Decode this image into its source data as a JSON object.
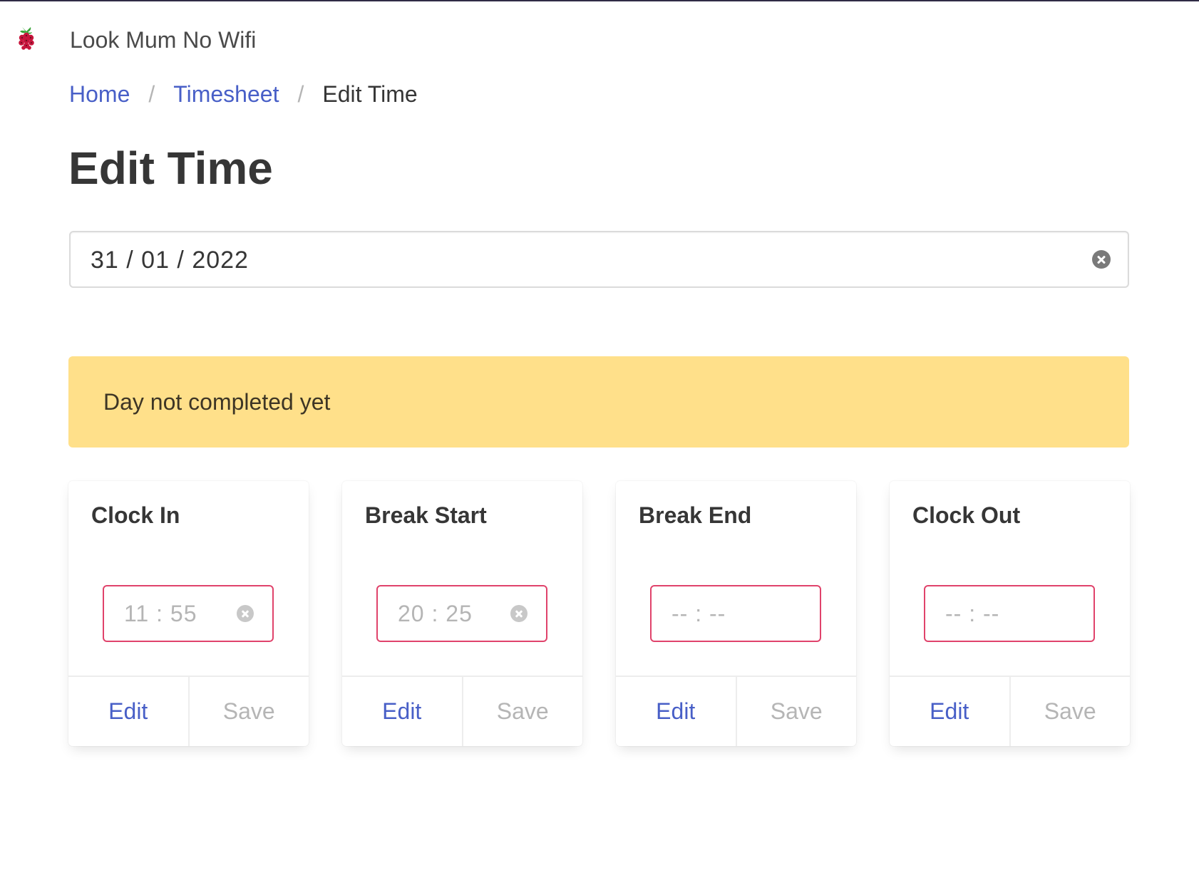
{
  "app": {
    "title": "Look Mum No Wifi",
    "logo_icon": "raspberry-pi-logo"
  },
  "breadcrumb": {
    "items": [
      {
        "label": "Home",
        "link": true
      },
      {
        "label": "Timesheet",
        "link": true
      },
      {
        "label": "Edit Time",
        "link": false
      }
    ],
    "separator": "/"
  },
  "page": {
    "title": "Edit Time"
  },
  "date_field": {
    "value": "31 / 01 / 2022",
    "clear_icon": "clear-icon"
  },
  "notification": {
    "text": "Day not completed yet",
    "color": "#ffe08a"
  },
  "cards": [
    {
      "title": "Clock In",
      "time": "11 : 55",
      "has_value": true,
      "edit_label": "Edit",
      "save_label": "Save"
    },
    {
      "title": "Break Start",
      "time": "20 : 25",
      "has_value": true,
      "edit_label": "Edit",
      "save_label": "Save"
    },
    {
      "title": "Break End",
      "time": "-- : --",
      "has_value": false,
      "edit_label": "Edit",
      "save_label": "Save"
    },
    {
      "title": "Clock Out",
      "time": "-- : --",
      "has_value": false,
      "edit_label": "Edit",
      "save_label": "Save"
    }
  ],
  "colors": {
    "link": "#485fc7",
    "danger_border": "#e0436b",
    "muted_text": "#b5b5b5",
    "warning_bg": "#ffe08a"
  }
}
